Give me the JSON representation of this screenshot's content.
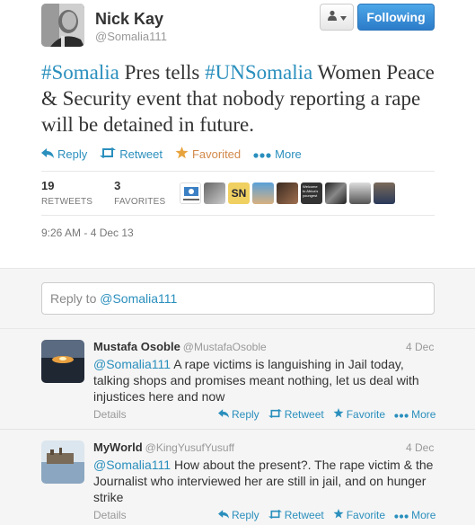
{
  "tweet": {
    "author_name": "Nick Kay",
    "author_handle": "@Somalia111",
    "follow_label": "Following",
    "text_parts": [
      {
        "text": "#Somalia",
        "type": "hashtag"
      },
      {
        "text": " Pres tells ",
        "type": "text"
      },
      {
        "text": "#UNSomalia",
        "type": "hashtag"
      },
      {
        "text": " Women Peace & Security event that nobody reporting a rape will be detained in future.",
        "type": "text"
      }
    ],
    "actions": {
      "reply": "Reply",
      "retweet": "Retweet",
      "favorited": "Favorited",
      "more": "More"
    },
    "stats": {
      "retweets_count": "19",
      "retweets_label": "RETWEETS",
      "favorites_count": "3",
      "favorites_label": "FAVORITES"
    },
    "timestamp": "9:26 AM - 4 Dec 13"
  },
  "reply_box": {
    "prefix": "Reply to ",
    "mention": "@Somalia111"
  },
  "replies": [
    {
      "name": "Mustafa Osoble",
      "handle": "@MustafaOsoble",
      "date": "4 Dec",
      "mention": "@Somalia111",
      "text": " A rape victims is languishing in Jail today, talking shops and promises meant nothing, let us deal with injustices here and now",
      "details": "Details",
      "reply": "Reply",
      "retweet": "Retweet",
      "favorite": "Favorite",
      "more": "More"
    },
    {
      "name": "MyWorld",
      "handle": "@KingYusufYusuff",
      "date": "4 Dec",
      "mention": "@Somalia111",
      "text": " How about the present?. The rape victim & the Journalist who interviewed her are still in jail, and on hunger strike",
      "details": "Details",
      "reply": "Reply",
      "retweet": "Retweet",
      "favorite": "Favorite",
      "more": "More"
    }
  ],
  "mini_avatar_logo_text": "SN",
  "mini_avatar_banner_text": "Welcome to Africa's youngest",
  "colors": {
    "link": "#2a8fbd",
    "favorite": "#d2894a",
    "follow_button": "#2b7bc9",
    "muted": "#999999"
  },
  "icons": [
    "user-menu-icon",
    "reply-icon",
    "retweet-icon",
    "star-icon",
    "more-dots-icon"
  ]
}
